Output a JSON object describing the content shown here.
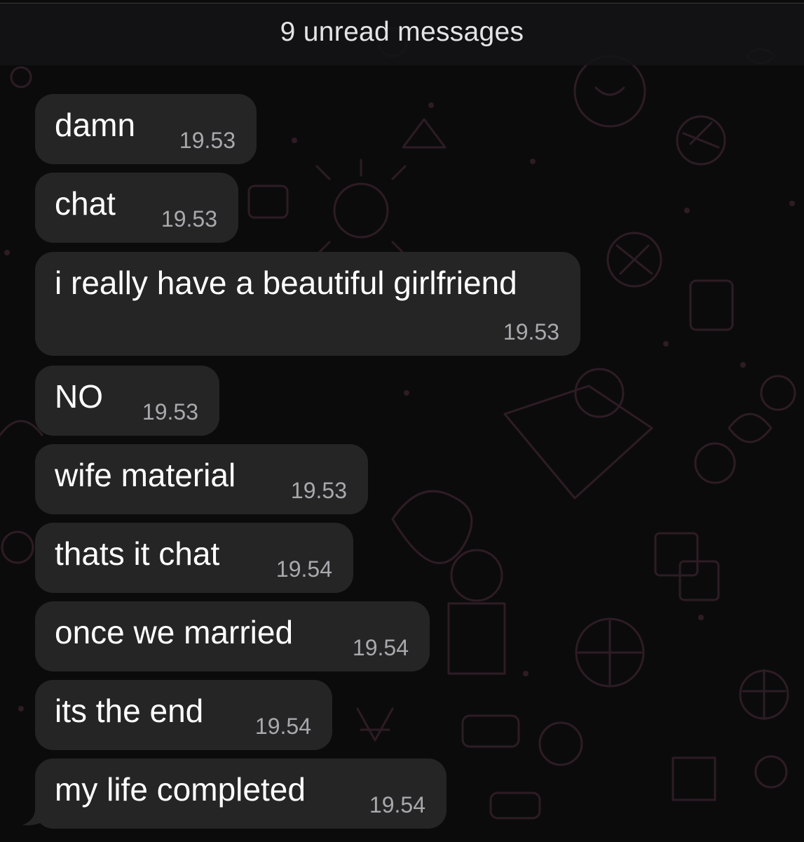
{
  "banner": {
    "unread_label": "9 unread messages"
  },
  "colors": {
    "background": "#0b0b0c",
    "bubble": "#252526",
    "message_text": "#ffffff",
    "timestamp_text": "#a9a9ad",
    "wallpaper_doodles": "#2e1c24"
  },
  "messages": [
    {
      "text": "damn",
      "time": "19.53"
    },
    {
      "text": "chat",
      "time": "19.53"
    },
    {
      "text": "i really have a beautiful girlfriend",
      "time": "19.53"
    },
    {
      "text": "NO",
      "time": "19.53"
    },
    {
      "text": "wife material",
      "time": "19.53"
    },
    {
      "text": "thats it chat",
      "time": "19.54"
    },
    {
      "text": "once we married",
      "time": "19.54"
    },
    {
      "text": "its the end",
      "time": "19.54"
    },
    {
      "text": "my life completed",
      "time": "19.54"
    }
  ]
}
